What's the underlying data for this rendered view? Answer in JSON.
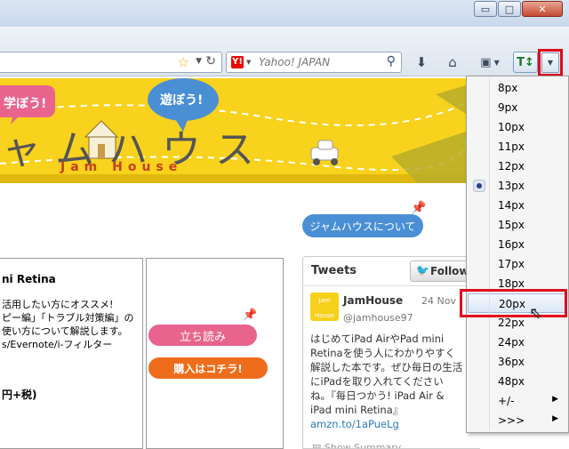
{
  "window": {
    "min_label": "▭",
    "max_label": "□",
    "close_label": "✕"
  },
  "toolbar": {
    "search_placeholder": "Yahoo! JAPAN"
  },
  "banner": {
    "bubble_left": "学ぼう!",
    "bubble_right": "遊ぼう!",
    "katakana": "ャムハウス",
    "logo_text": "Jam House"
  },
  "page": {
    "about_button": "ジャムハウスについて",
    "book_title": "ni Retina",
    "desc_lines": [
      "活用したい方にオススメ!",
      "ピー編」「トラブル対策編」の",
      "使い方について解説します。",
      "s/Evernote/i-フィルター"
    ],
    "price": "円+税)",
    "tachiyomi": "立ち読み",
    "buy": "購入はコチラ!"
  },
  "tweets": {
    "header": "Tweets",
    "follow": "Follow",
    "avatar_line1": "Jam",
    "avatar_line2": "House",
    "user": "JamHouse",
    "date": "24 Nov",
    "handle": "@jamhouse97",
    "body": "はじめてiPad AirやPad mini Retinaを使う人にわかりやすく解説した本です。ぜひ毎日の生活にiPadを取り入れてくださいね。『毎日つかう! iPad Air & iPad mini Retina』",
    "link": "amzn.to/1aPueLg",
    "summary": "Show Summary"
  },
  "menu": {
    "items": [
      "8px",
      "9px",
      "10px",
      "11px",
      "12px",
      "13px",
      "14px",
      "15px",
      "16px",
      "17px",
      "18px",
      "20px",
      "22px",
      "24px",
      "36px",
      "48px",
      "+/-",
      ">>>"
    ],
    "selected": "13px",
    "hovered": "20px"
  },
  "colors": {
    "accent_red": "#e10b1b",
    "banner_yellow": "#f8d21c",
    "about_blue": "#4a8fd4",
    "pink": "#e8648e",
    "orange": "#ee6d1c"
  }
}
